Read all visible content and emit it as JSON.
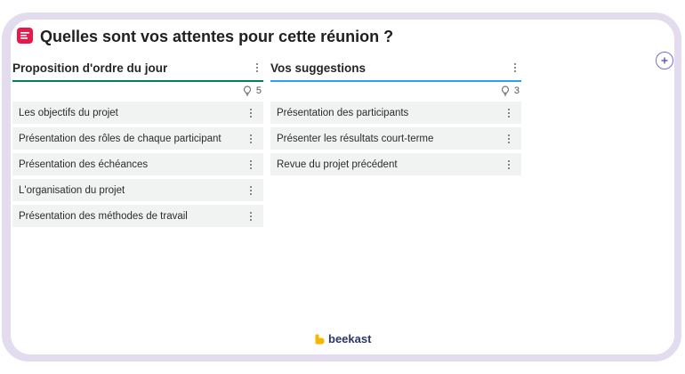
{
  "page": {
    "title": "Quelles sont vos attentes pour cette réunion ?"
  },
  "columns": [
    {
      "title": "Proposition d'ordre du jour",
      "count": "5",
      "accent": "#00805a",
      "items": [
        "Les objectifs du projet",
        "Présentation des rôles de chaque participant",
        "Présentation des échéances",
        "L'organisation du projet",
        "Présentation des méthodes de travail"
      ]
    },
    {
      "title": "Vos suggestions",
      "count": "3",
      "accent": "#2aa0f0",
      "items": [
        "Présentation des participants",
        "Présenter les résultats court-terme",
        "Revue du projet précédent"
      ]
    }
  ],
  "branding": {
    "name": "beekast",
    "logo_color": "#f5b800",
    "app_icon_color": "#e6194b"
  },
  "icons": {
    "count": "lightbulb-icon",
    "menu": "kebab-menu-icon",
    "add": "plus-icon"
  }
}
